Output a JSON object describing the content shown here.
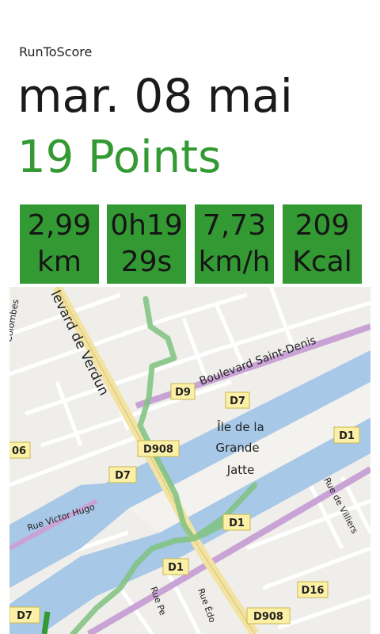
{
  "app": {
    "name": "RunToScore"
  },
  "run": {
    "date": "mar. 08 mai",
    "points": "19 Points"
  },
  "stats": [
    {
      "line1": "2,99",
      "line2": "km"
    },
    {
      "line1": "0h19",
      "line2": "29s"
    },
    {
      "line1": "7,73",
      "line2": "km/h"
    },
    {
      "line1": "209",
      "line2": "Kcal"
    }
  ],
  "map": {
    "roads": {
      "boulevard_verdun": "levard de Verdun",
      "boulevard_saint_denis": "Boulevard Saint-Denis",
      "rue_victor_hugo": "Rue Victor Hugo",
      "rue_de_villiers": "Rue de Villiers",
      "colombes": "Colombes",
      "rue_pe": "Rue Pe",
      "rue_ed": "Rue Édo"
    },
    "island": {
      "line1": "Île de la",
      "line2": "Grande",
      "line3": "Jatte"
    },
    "shields": {
      "d9": "D9",
      "d7_top": "D7",
      "d1_right": "D1",
      "d06": "06",
      "d908_mid": "D908",
      "d7_mid": "D7",
      "d1_center": "D1",
      "d1_lower": "D1",
      "d16": "D16",
      "d7_left": "D7",
      "d908_bottom": "D908"
    },
    "colors": {
      "river": "#a8c8e8",
      "route": "#7fc27f",
      "highway": "#c9a3d6",
      "main_road": "#f3e3a2",
      "minor_road": "#ffffff"
    }
  },
  "colors": {
    "accent": "#339933"
  }
}
